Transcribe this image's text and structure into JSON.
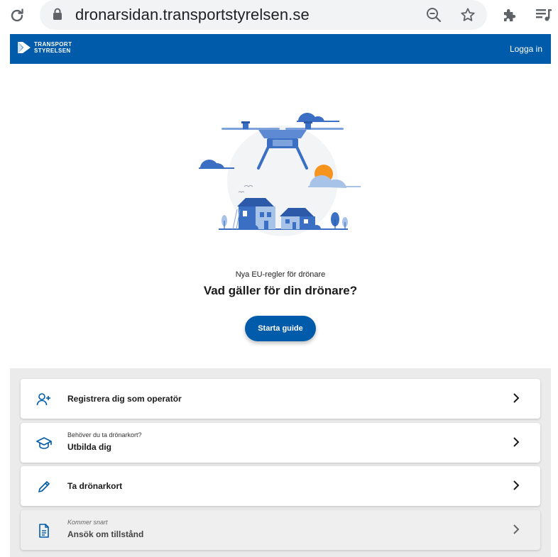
{
  "browser": {
    "url": "dronarsidan.transportstyrelsen.se"
  },
  "header": {
    "logo_line1": "TRANSPORT",
    "logo_line2": "STYRELSEN",
    "login_label": "Logga in"
  },
  "hero": {
    "eyebrow": "Nya EU-regler för drönare",
    "headline": "Vad gäller för din drönare?",
    "cta_label": "Starta guide"
  },
  "cards": [
    {
      "subtitle": "",
      "title": "Registrera dig som operatör",
      "icon": "add-user-icon",
      "disabled": false
    },
    {
      "subtitle": "Behöver du ta drönarkort?",
      "title": "Utbilda dig",
      "icon": "graduation-cap-icon",
      "disabled": false
    },
    {
      "subtitle": "",
      "title": "Ta drönarkort",
      "icon": "pencil-icon",
      "disabled": false
    },
    {
      "subtitle": "Kommer snart",
      "title": "Ansök om tillstånd",
      "icon": "document-icon",
      "disabled": true
    }
  ],
  "colors": {
    "brand": "#005baa",
    "lower_bg": "#ebebeb",
    "illustration_blue": "#3b6fc4",
    "illustration_light": "#a8c3e8",
    "sun": "#f7941d"
  }
}
